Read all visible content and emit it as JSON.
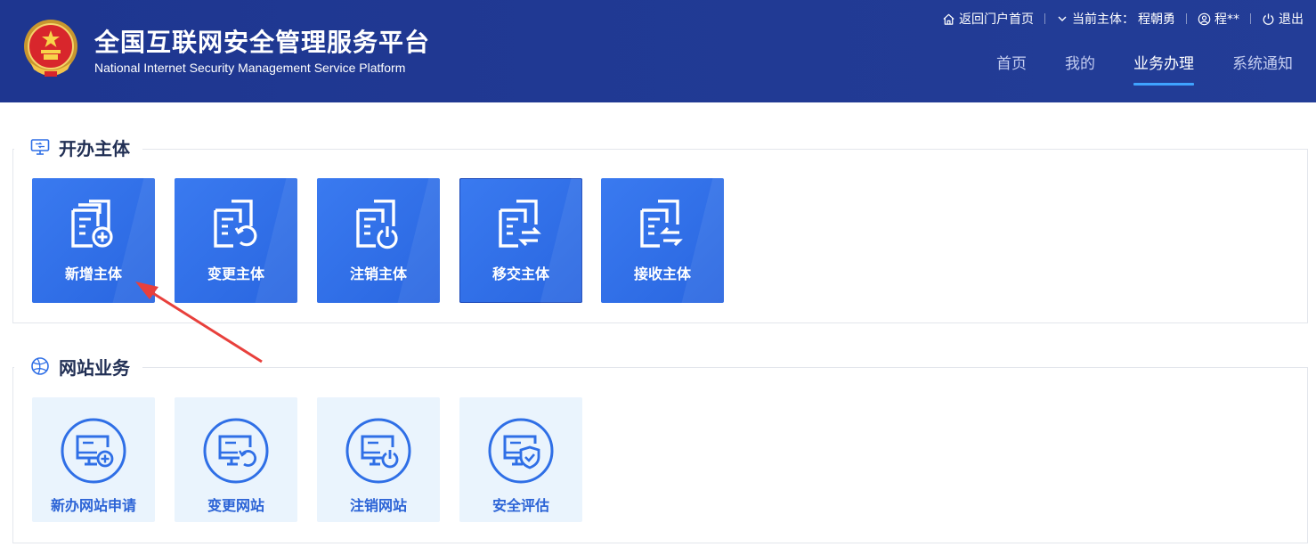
{
  "header": {
    "title_cn": "全国互联网安全管理服务平台",
    "title_en": "National Internet Security Management Service Platform",
    "top_links": {
      "portal": "返回门户首页",
      "subject_label": "当前主体：",
      "subject_name": "程朝勇",
      "user": "程**",
      "logout": "退出"
    },
    "nav": [
      {
        "label": "首页",
        "active": false
      },
      {
        "label": "我的",
        "active": false
      },
      {
        "label": "业务办理",
        "active": true
      },
      {
        "label": "系统通知",
        "active": false
      }
    ]
  },
  "sections": {
    "entity": {
      "title": "开办主体",
      "tiles": [
        {
          "label": "新增主体",
          "icon": "document-add-icon"
        },
        {
          "label": "变更主体",
          "icon": "document-change-icon"
        },
        {
          "label": "注销主体",
          "icon": "document-cancel-icon"
        },
        {
          "label": "移交主体",
          "icon": "document-transfer-icon"
        },
        {
          "label": "接收主体",
          "icon": "document-receive-icon"
        }
      ]
    },
    "website": {
      "title": "网站业务",
      "tiles": [
        {
          "label": "新办网站申请",
          "icon": "monitor-add-icon"
        },
        {
          "label": "变更网站",
          "icon": "monitor-change-icon"
        },
        {
          "label": "注销网站",
          "icon": "monitor-cancel-icon"
        },
        {
          "label": "安全评估",
          "icon": "monitor-shield-icon"
        }
      ]
    }
  },
  "colors": {
    "header_bg": "#1f3a93",
    "tile_blue": "#2f6fe6",
    "tile_light": "#eaf4fd",
    "nav_active_underline": "#3fa3ff",
    "annotation_arrow": "#e8403c"
  }
}
